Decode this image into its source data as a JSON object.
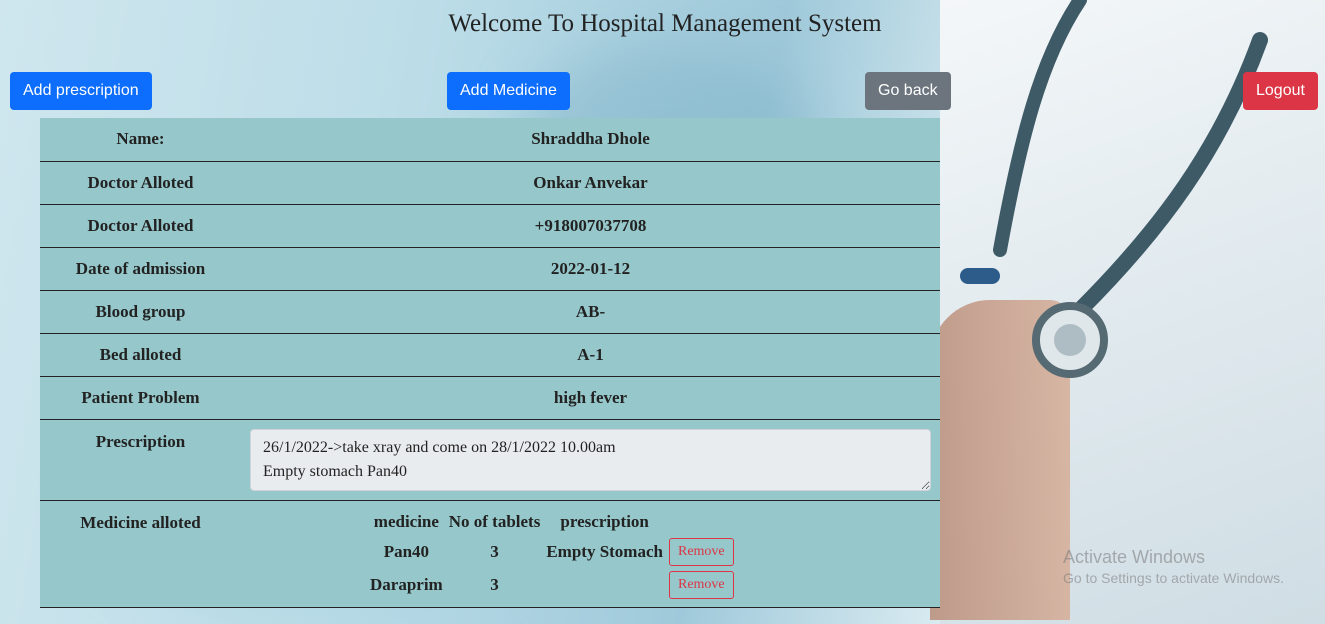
{
  "header": {
    "title": "Welcome To Hospital Management System"
  },
  "toolbar": {
    "add_prescription": "Add prescription",
    "add_medicine": "Add Medicine",
    "go_back": "Go back",
    "logout": "Logout"
  },
  "patient": {
    "rows": [
      {
        "label": "Name:",
        "value": "Shraddha Dhole"
      },
      {
        "label": "Doctor Alloted",
        "value": "Onkar Anvekar"
      },
      {
        "label": "Doctor Alloted",
        "value": "+918007037708"
      },
      {
        "label": "Date of admission",
        "value": "2022-01-12"
      },
      {
        "label": "Blood group",
        "value": "AB-"
      },
      {
        "label": "Bed alloted",
        "value": "A-1"
      },
      {
        "label": "Patient Problem",
        "value": "high fever"
      }
    ],
    "prescription_label": "Prescription",
    "prescription_text": "26/1/2022->take xray and come on 28/1/2022 10.00am\nEmpty stomach Pan40",
    "medicine_label": "Medicine alloted",
    "medicine_headers": [
      "medicine",
      "No of tablets",
      "prescription"
    ],
    "medicines": [
      {
        "name": "Pan40",
        "tablets": "3",
        "prescription": "Empty Stomach",
        "action": "Remove"
      },
      {
        "name": "Daraprim",
        "tablets": "3",
        "prescription": "",
        "action": "Remove"
      }
    ]
  },
  "watermark": {
    "line1": "Activate Windows",
    "line2": "Go to Settings to activate Windows."
  }
}
